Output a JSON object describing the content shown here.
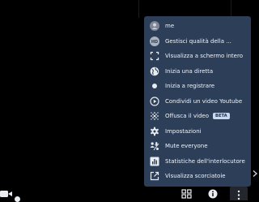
{
  "menu": {
    "items": [
      {
        "label": "me",
        "icon": "avatar-icon"
      },
      {
        "label": "Gestisci qualità della ...",
        "icon": "hd-icon"
      },
      {
        "label": "Visualizza a schermo intero",
        "icon": "fullscreen-icon"
      },
      {
        "label": "Inizia una diretta",
        "icon": "livestream-globe-icon"
      },
      {
        "label": "Inizia a registrare",
        "icon": "record-icon"
      },
      {
        "label": "Condividi un video Youtube",
        "icon": "play-circle-icon"
      },
      {
        "label": "Offusca il video",
        "icon": "blur-icon",
        "badge": "BETA"
      },
      {
        "label": "Impostazioni",
        "icon": "gear-icon"
      },
      {
        "label": "Mute everyone",
        "icon": "mute-everyone-icon"
      },
      {
        "label": "Statistiche dell'interlocutore",
        "icon": "bar-chart-icon"
      },
      {
        "label": "Visualizza scorciatoie",
        "icon": "external-link-icon"
      }
    ]
  },
  "colors": {
    "menu_bg": "#2d3e58",
    "menu_text": "#f1f4f8",
    "badge_bg": "#c5d9f1",
    "page_bg": "#000000"
  }
}
